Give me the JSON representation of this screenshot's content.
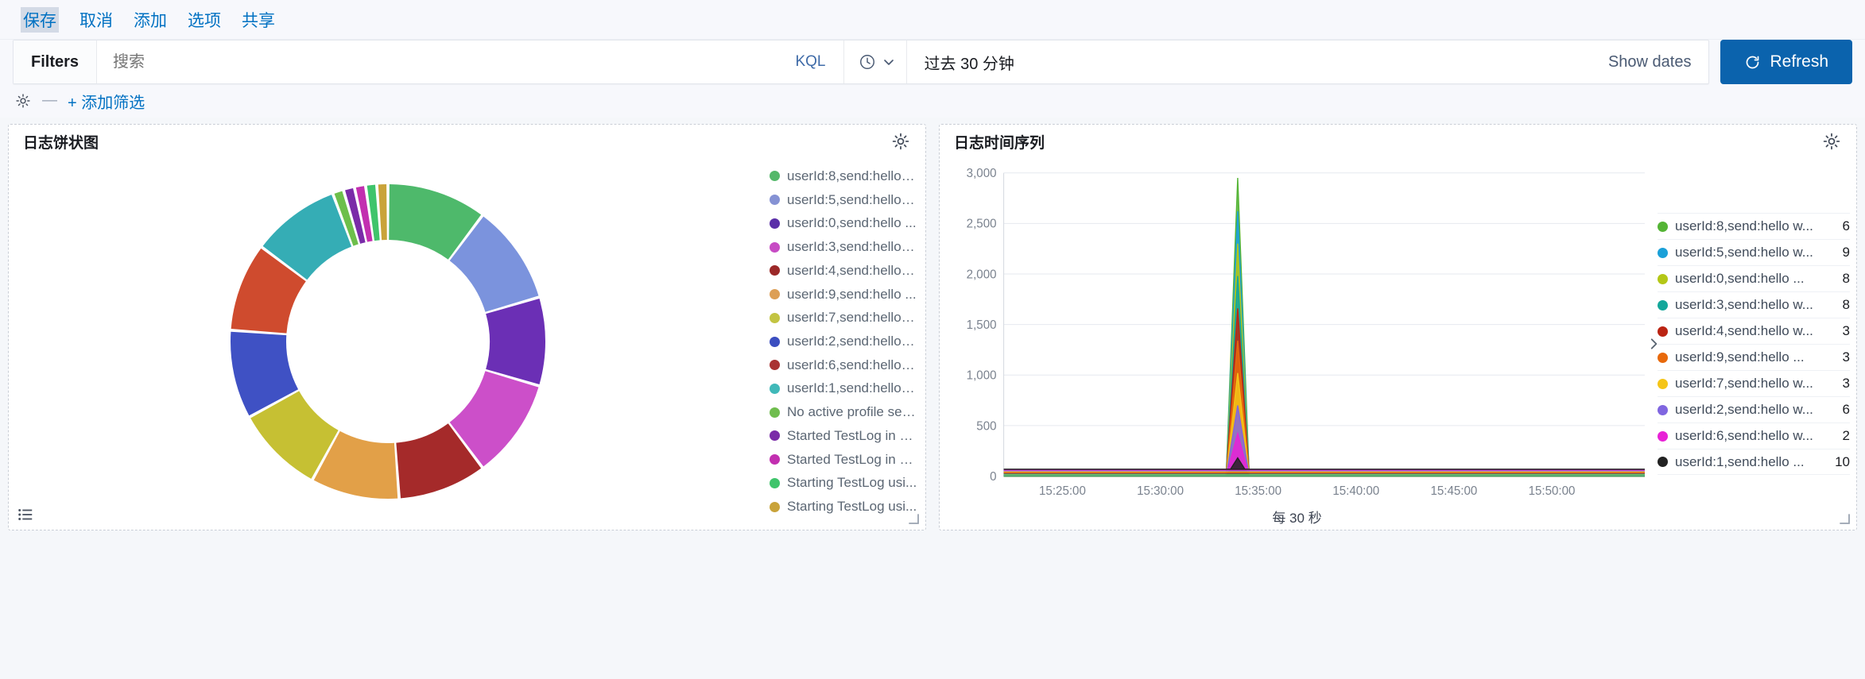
{
  "topbar": {
    "items": [
      {
        "label": "保存",
        "name": "menu-save",
        "selected": true
      },
      {
        "label": "取消",
        "name": "menu-cancel",
        "selected": false
      },
      {
        "label": "添加",
        "name": "menu-add",
        "selected": false
      },
      {
        "label": "选项",
        "name": "menu-options",
        "selected": false
      },
      {
        "label": "共享",
        "name": "menu-share",
        "selected": false
      }
    ]
  },
  "querybar": {
    "filters_label": "Filters",
    "search_value": "",
    "search_placeholder": "搜索",
    "kql_label": "KQL",
    "date_range": "过去 30 分钟",
    "show_dates_label": "Show dates",
    "refresh_label": "Refresh"
  },
  "filterrow": {
    "dash": "—",
    "add_filter_label": "+ 添加筛选"
  },
  "panels": {
    "pie": {
      "title": "日志饼状图"
    },
    "timeseries": {
      "title": "日志时间序列"
    }
  },
  "colors": {
    "accent_blue": "#0071c2",
    "refresh_blue": "#0b63ad",
    "panel_border": "#c9ced6"
  },
  "chart_data": [
    {
      "type": "pie",
      "title": "日志饼状图",
      "donut": true,
      "legend_position": "right",
      "labels": [
        "userId:8,send:hello w...",
        "userId:5,send:hello w...",
        "userId:0,send:hello ...",
        "userId:3,send:hello w...",
        "userId:4,send:hello w...",
        "userId:9,send:hello ...",
        "userId:7,send:hello w...",
        "userId:2,send:hello w...",
        "userId:6,send:hello w...",
        "userId:1,send:hello w...",
        "No active profile set,...",
        "Started TestLog in 3...",
        "Started TestLog in 4...",
        "Starting TestLog usi...",
        "Starting TestLog usi..."
      ],
      "values": [
        9,
        9,
        8,
        9,
        8,
        8,
        8,
        8,
        8,
        8,
        1,
        1,
        1,
        1,
        1
      ],
      "slice_colors": [
        "#4eb96b",
        "#7b93dd",
        "#6b2fb5",
        "#cc4fc9",
        "#a52a2a",
        "#e2a048",
        "#c6c033",
        "#3f51c4",
        "#cf4b2e",
        "#35adb5",
        "#6dbf4b",
        "#7a2ba8",
        "#c22fb0",
        "#3fc46b",
        "#c9a33a"
      ],
      "legend_dot_colors": [
        "#54b86a",
        "#8592d4",
        "#5a2fa8",
        "#c74bc4",
        "#9b2828",
        "#dd9f55",
        "#c3c442",
        "#3b4ec0",
        "#a93232",
        "#40b9b9",
        "#6fbd4e",
        "#7a2ba8",
        "#c22fb0",
        "#3fc46b",
        "#c9a33a"
      ]
    },
    {
      "type": "area",
      "stacked": true,
      "title": "日志时间序列",
      "xlabel": "每 30 秒",
      "ylabel": "",
      "ylim": [
        0,
        3000
      ],
      "yticks": [
        0,
        500,
        1000,
        1500,
        2000,
        2500,
        3000
      ],
      "ytick_labels": [
        "0",
        "500",
        "1,000",
        "1,500",
        "2,000",
        "2,500",
        "3,000"
      ],
      "xtick_labels": [
        "15:25:00",
        "15:30:00",
        "15:35:00",
        "15:40:00",
        "15:45:00",
        "15:50:00"
      ],
      "grid": true,
      "legend_position": "right",
      "spike_time": "15:33:00",
      "spike_total": 2950,
      "series": [
        {
          "name": "userId:8,send:hello w...",
          "value": 6,
          "color": "#54b435",
          "peak": 2950
        },
        {
          "name": "userId:5,send:hello w...",
          "value": 9,
          "color": "#1ba0d8",
          "peak": 2620
        },
        {
          "name": "userId:0,send:hello ...",
          "value": 8,
          "color": "#b4c717",
          "peak": 2300
        },
        {
          "name": "userId:3,send:hello w...",
          "value": 8,
          "color": "#14a79a",
          "peak": 1980
        },
        {
          "name": "userId:4,send:hello w...",
          "value": 3,
          "color": "#bb2413",
          "peak": 1660
        },
        {
          "name": "userId:9,send:hello ...",
          "value": 3,
          "color": "#e8690b",
          "peak": 1340
        },
        {
          "name": "userId:7,send:hello w...",
          "value": 3,
          "color": "#f5c518",
          "peak": 1020
        },
        {
          "name": "userId:2,send:hello w...",
          "value": 6,
          "color": "#8066e0",
          "peak": 700
        },
        {
          "name": "userId:6,send:hello w...",
          "value": 2,
          "color": "#e822d6",
          "peak": 420
        },
        {
          "name": "userId:1,send:hello ...",
          "value": 10,
          "color": "#222222",
          "peak": 180
        }
      ]
    }
  ]
}
